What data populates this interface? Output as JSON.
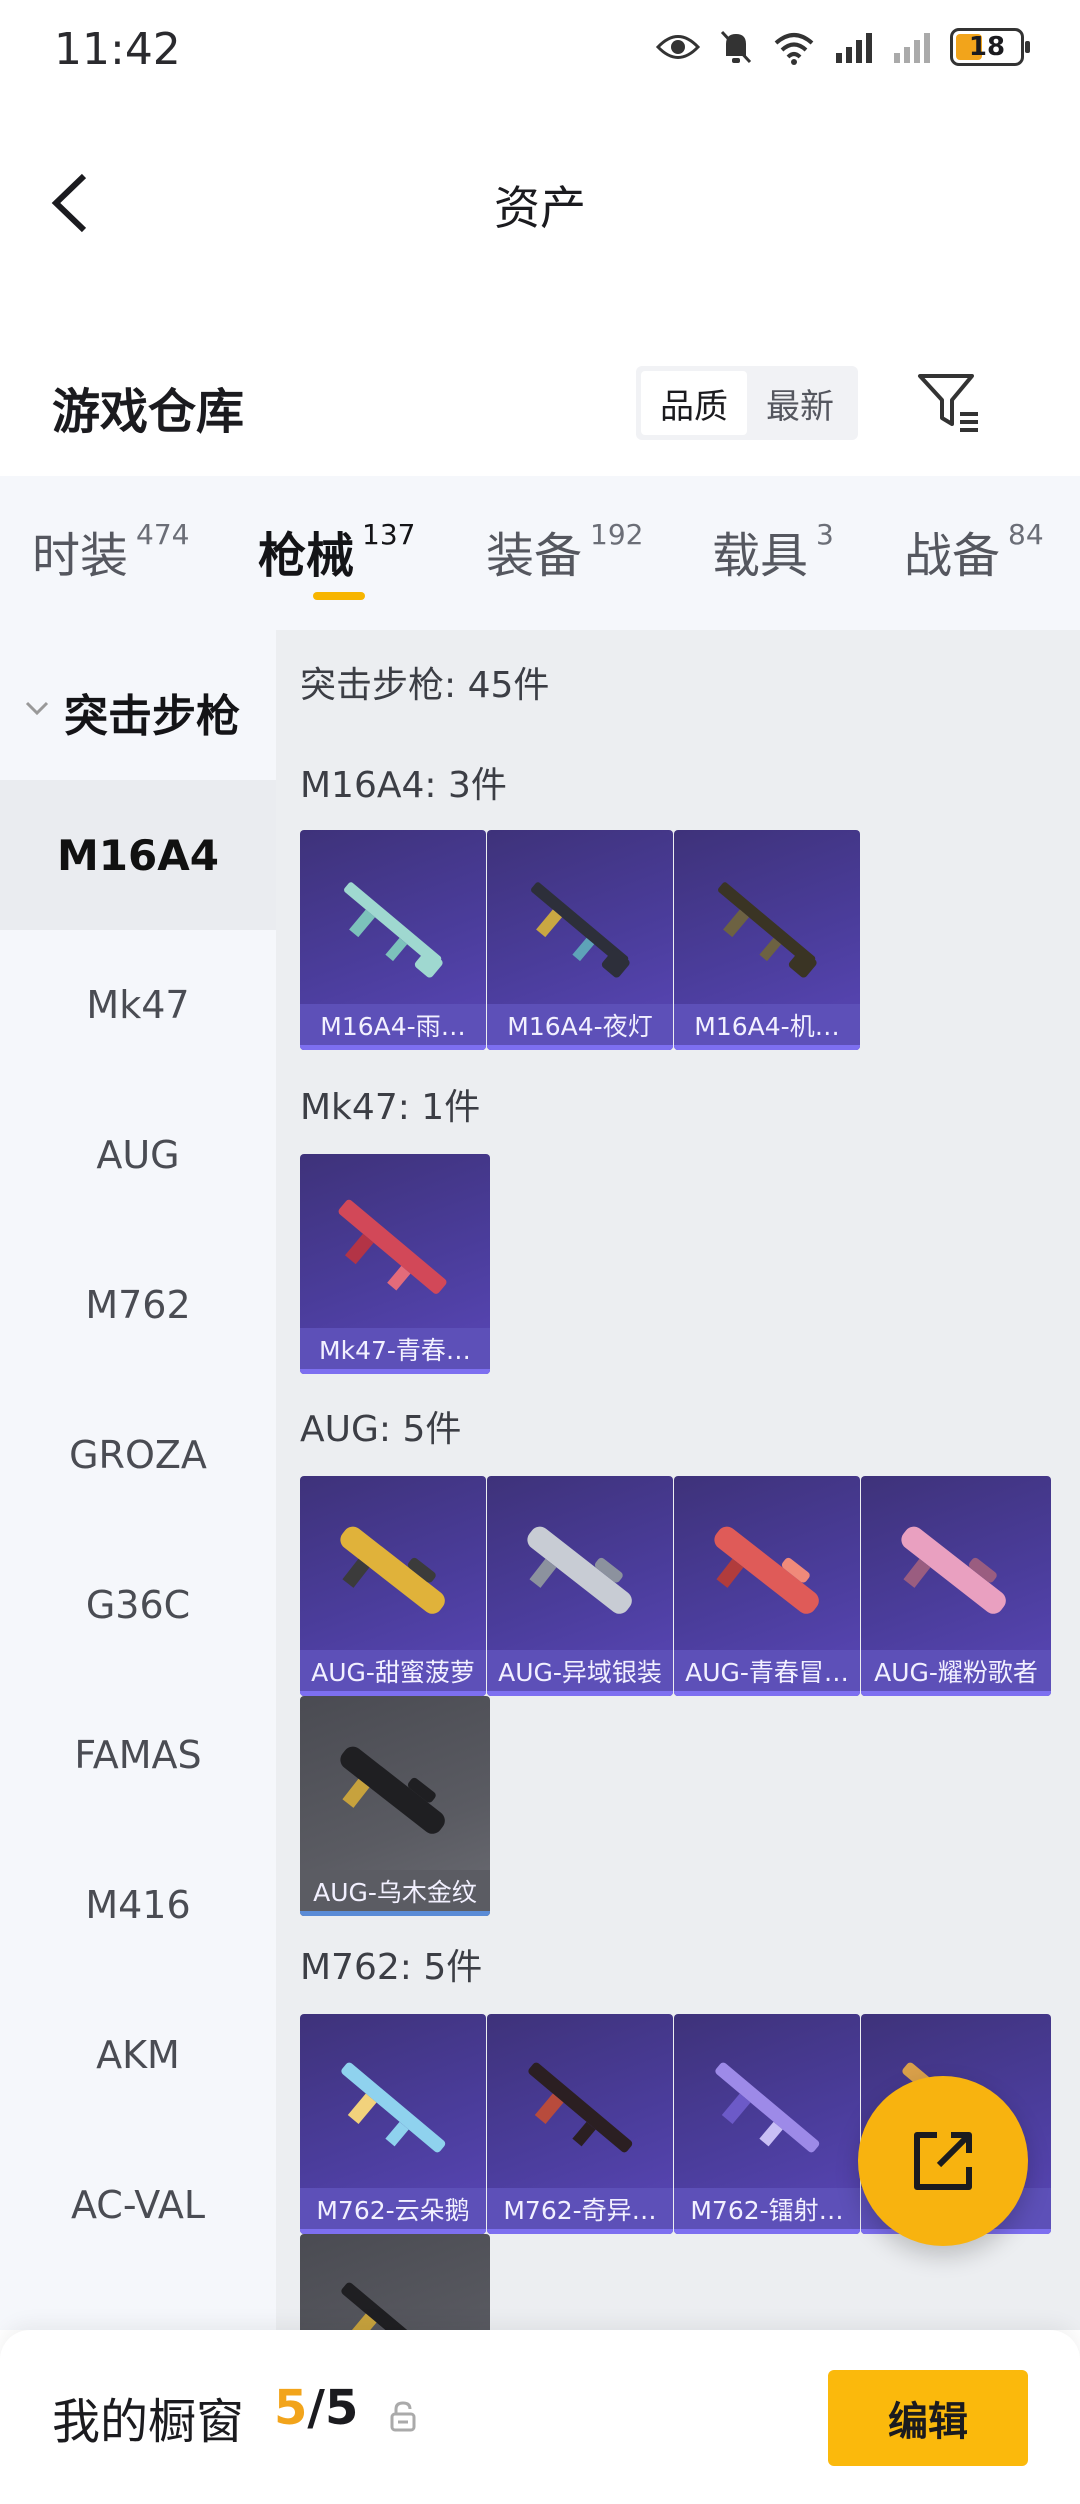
{
  "status_bar": {
    "time": "11:42",
    "battery": "18"
  },
  "header": {
    "title": "资产"
  },
  "warehouse": {
    "title": "游戏仓库",
    "sort_options": [
      "品质",
      "最新"
    ],
    "active_sort": "品质"
  },
  "tabs": [
    {
      "label": "时装",
      "count": "474"
    },
    {
      "label": "枪械",
      "count": "137"
    },
    {
      "label": "装备",
      "count": "192"
    },
    {
      "label": "载具",
      "count": "3"
    },
    {
      "label": "战备",
      "count": "84"
    }
  ],
  "active_tab": "枪械",
  "sidebar": {
    "group": "突击步枪",
    "items": [
      "M16A4",
      "Mk47",
      "AUG",
      "M762",
      "GROZA",
      "G36C",
      "FAMAS",
      "M416",
      "AKM",
      "AC-VAL"
    ],
    "active_item": "M16A4"
  },
  "content": {
    "summary": "突击步枪: 45件",
    "sections": [
      {
        "heading": "M16A4: 3件",
        "items": [
          "M16A4-雨…",
          "M16A4-夜灯",
          "M16A4-机…"
        ]
      },
      {
        "heading": "Mk47: 1件",
        "items": [
          "Mk47-青春…"
        ]
      },
      {
        "heading": "AUG: 5件",
        "items": [
          "AUG-甜蜜菠萝",
          "AUG-异域银装",
          "AUG-青春冒…",
          "AUG-耀粉歌者",
          "AUG-乌木金纹"
        ]
      },
      {
        "heading": "M762: 5件",
        "items": [
          "M762-云朵鹅",
          "M762-奇异…",
          "M762-镭射…",
          "…"
        ]
      }
    ]
  },
  "bottom_bar": {
    "label": "我的橱窗",
    "current": "5",
    "separator": "/",
    "max": "5",
    "edit_label": "编辑"
  },
  "colors": {
    "accent": "#f7b500",
    "card_purple": "#4b3d9c",
    "card_grey": "#5a5b62",
    "sidebar_bg": "#f5f7fb",
    "content_bg": "#eceef1"
  }
}
